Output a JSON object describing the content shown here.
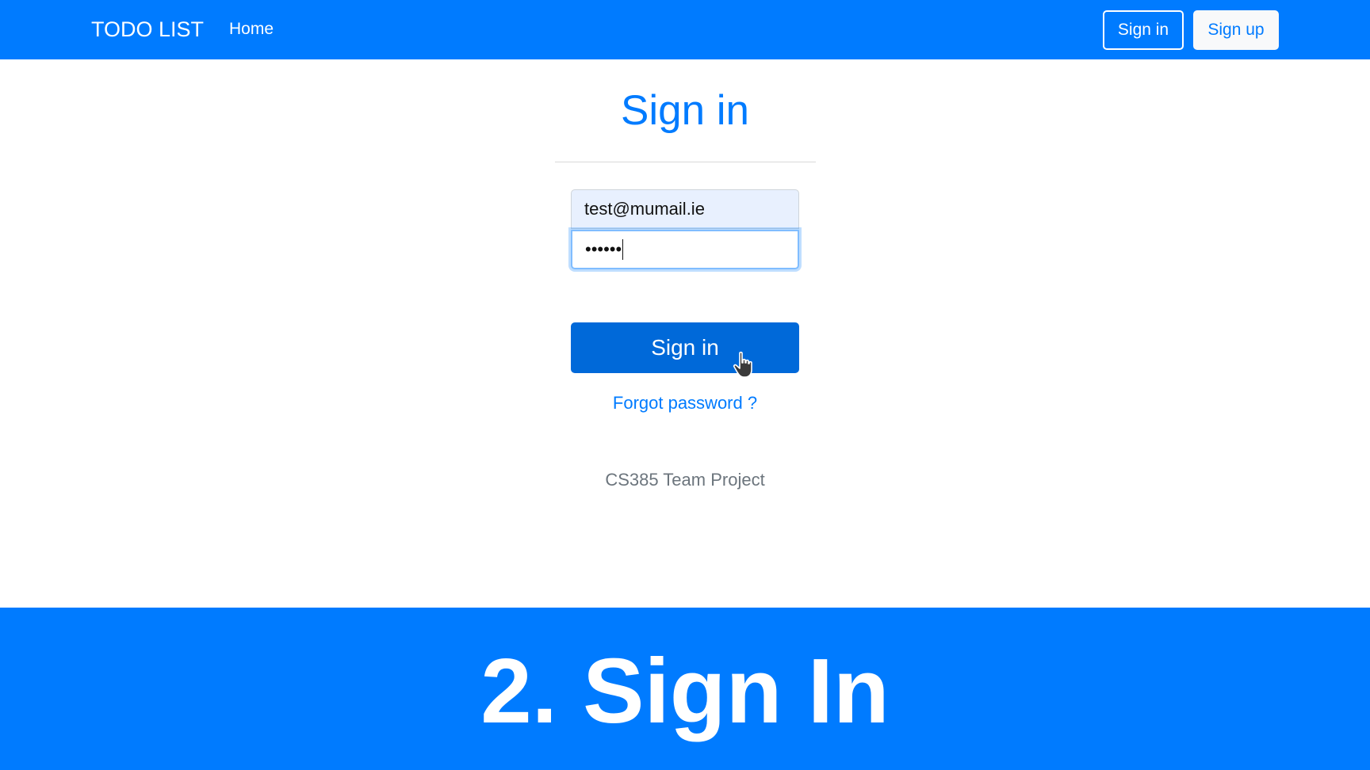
{
  "navbar": {
    "brand": "TODO LIST",
    "home_label": "Home",
    "signin_label": "Sign in",
    "signup_label": "Sign up"
  },
  "form": {
    "title": "Sign in",
    "email_value": "test@mumail.ie",
    "password_masked": "••••••",
    "submit_label": "Sign in",
    "forgot_label": "Forgot password ?"
  },
  "footer": {
    "text": "CS385 Team Project"
  },
  "banner": {
    "text": "2. Sign In"
  },
  "colors": {
    "primary": "#007bff",
    "primary_dark": "#0069d9",
    "muted": "#6c757d",
    "autofill_bg": "#e8f0fe"
  },
  "icons": {
    "cursor": "hand-pointer-icon"
  }
}
